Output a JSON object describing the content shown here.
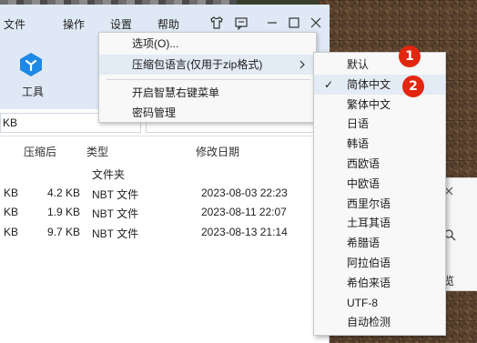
{
  "menubar": {
    "file": "文件",
    "edit": "操作",
    "settings": "设置",
    "help": "帮助"
  },
  "ribbon": {
    "tool_label": "工具"
  },
  "path": {
    "value": "KB"
  },
  "columns": {
    "compressed": "压缩后",
    "type": "类型",
    "modified": "修改日期"
  },
  "rows": [
    {
      "size": "",
      "compressed": "",
      "type": "文件夹",
      "date": ""
    },
    {
      "size": "KB",
      "compressed": "4.2 KB",
      "type": "NBT 文件",
      "date": "2023-08-03 22:23"
    },
    {
      "size": "KB",
      "compressed": "1.9 KB",
      "type": "NBT 文件",
      "date": "2023-08-11 22:07"
    },
    {
      "size": "KB",
      "compressed": "9.7 KB",
      "type": "NBT 文件",
      "date": "2023-08-13 21:14"
    }
  ],
  "context_menu": {
    "options": "选项(O)...",
    "archive_language": "压缩包语言(仅用于zip格式)",
    "smart_context": "开启智慧右键菜单",
    "password": "密码管理"
  },
  "submenu": {
    "items": [
      "默认",
      "简体中文",
      "繁体中文",
      "日语",
      "韩语",
      "西欧语",
      "中欧语",
      "西里尔语",
      "土耳其语",
      "希腊语",
      "阿拉伯语",
      "希伯来语",
      "UTF-8",
      "自动检测"
    ],
    "checked": "✓"
  },
  "badges": [
    "1",
    "2"
  ],
  "side_panel": {
    "label": "览"
  },
  "colors": {
    "accent": "#1e88e5",
    "badge": "#e3260f",
    "highlight": "#e3ebf5"
  }
}
